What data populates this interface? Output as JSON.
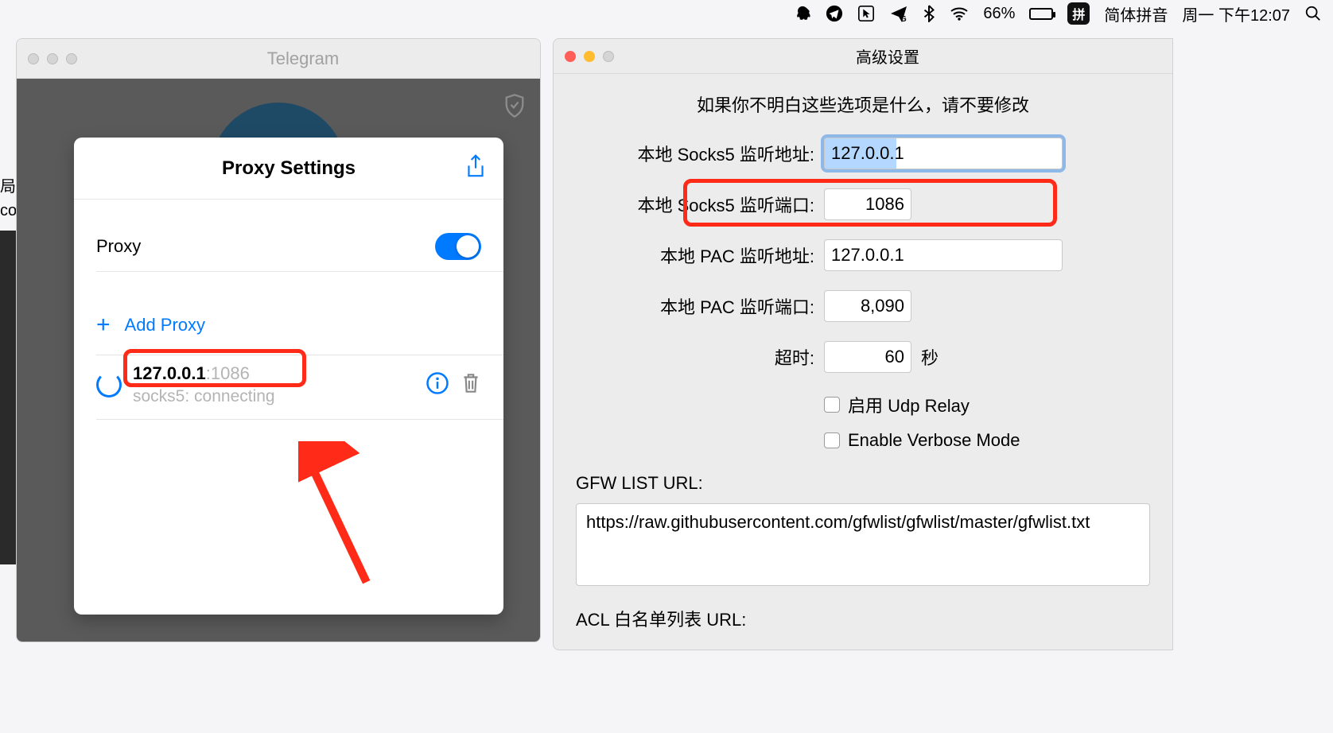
{
  "menubar": {
    "battery_pct": "66%",
    "ime_label": "拼",
    "ime_name": "简体拼音",
    "clock": "周一 下午12:07"
  },
  "telegram": {
    "title": "Telegram"
  },
  "left_strip": {
    "line1": "局",
    "line2": "co"
  },
  "proxy_popup": {
    "title": "Proxy Settings",
    "proxy_label": "Proxy",
    "add_proxy": "Add Proxy",
    "entry": {
      "host": "127.0.0.1",
      "port": ":1086",
      "status": "socks5: connecting"
    }
  },
  "advanced": {
    "title": "高级设置",
    "warning": "如果你不明白这些选项是什么，请不要修改",
    "fields": {
      "socks5_addr_label": "本地 Socks5 监听地址:",
      "socks5_addr_value": "127.0.0.1",
      "socks5_port_label": "本地 Socks5 监听端口:",
      "socks5_port_value": "1086",
      "pac_addr_label": "本地 PAC 监听地址:",
      "pac_addr_value": "127.0.0.1",
      "pac_port_label": "本地 PAC 监听端口:",
      "pac_port_value": "8,090",
      "timeout_label": "超时:",
      "timeout_value": "60",
      "timeout_suffix": "秒"
    },
    "checkboxes": {
      "udp_relay": "启用 Udp Relay",
      "verbose": "Enable Verbose Mode"
    },
    "gfw_label": "GFW LIST URL:",
    "gfw_value": "https://raw.githubusercontent.com/gfwlist/gfwlist/master/gfwlist.txt",
    "acl_label": "ACL 白名单列表 URL:"
  }
}
